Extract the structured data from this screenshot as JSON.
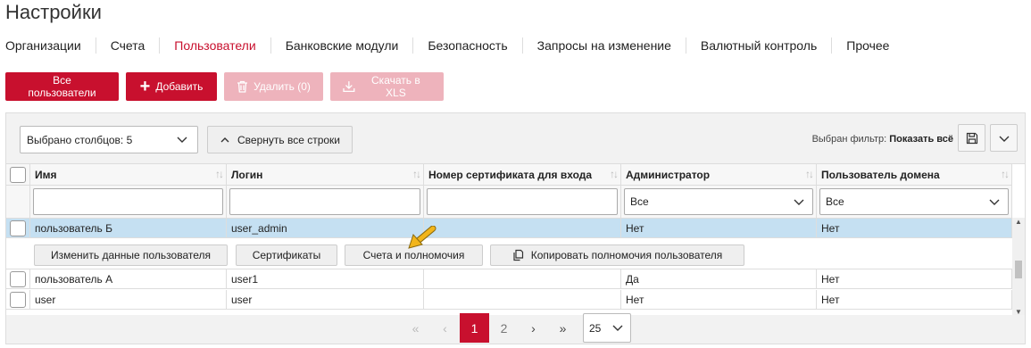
{
  "page": {
    "title": "Настройки"
  },
  "tabs": [
    {
      "label": "Организации",
      "active": false
    },
    {
      "label": "Счета",
      "active": false
    },
    {
      "label": "Пользователи",
      "active": true
    },
    {
      "label": "Банковские модули",
      "active": false
    },
    {
      "label": "Безопасность",
      "active": false
    },
    {
      "label": "Запросы на изменение",
      "active": false
    },
    {
      "label": "Валютный контроль",
      "active": false
    },
    {
      "label": "Прочее",
      "active": false
    }
  ],
  "toolbar": {
    "all_users": "Все пользователи",
    "add": "Добавить",
    "delete": "Удалить (0)",
    "download": "Скачать в XLS"
  },
  "grid_controls": {
    "columns_selected": "Выбрано столбцов: 5",
    "collapse_all": "Свернуть все строки",
    "filter_label": "Выбран фильтр:",
    "filter_value": "Показать всё"
  },
  "table": {
    "columns": [
      "Имя",
      "Логин",
      "Номер сертификата для входа",
      "Администратор",
      "Пользователь домена"
    ],
    "filters": {
      "name": "",
      "login": "",
      "cert": "",
      "admin": "Все",
      "domain": "Все"
    },
    "rows": [
      {
        "name": "пользователь Б",
        "login": "user_admin",
        "cert": "",
        "admin": "Нет",
        "domain": "Нет",
        "selected": true
      },
      {
        "name": "пользователь А",
        "login": "user1",
        "cert": "",
        "admin": "Да",
        "domain": "Нет",
        "selected": false
      },
      {
        "name": "user",
        "login": "user",
        "cert": "",
        "admin": "Нет",
        "domain": "Нет",
        "selected": false
      }
    ],
    "row_actions": {
      "edit_user": "Изменить данные пользователя",
      "certificates": "Сертификаты",
      "accounts_permissions": "Счета и полномочия",
      "copy_permissions": "Копировать полномочия пользователя"
    }
  },
  "pagination": {
    "first": "«",
    "prev": "‹",
    "pages": [
      "1",
      "2"
    ],
    "current": "1",
    "next": "›",
    "last": "»",
    "page_size": "25"
  },
  "colors": {
    "accent": "#c8102e",
    "accent_disabled": "#eeb3bc",
    "row_selected": "#c5e0f2",
    "pointer": "#f2b51b"
  }
}
